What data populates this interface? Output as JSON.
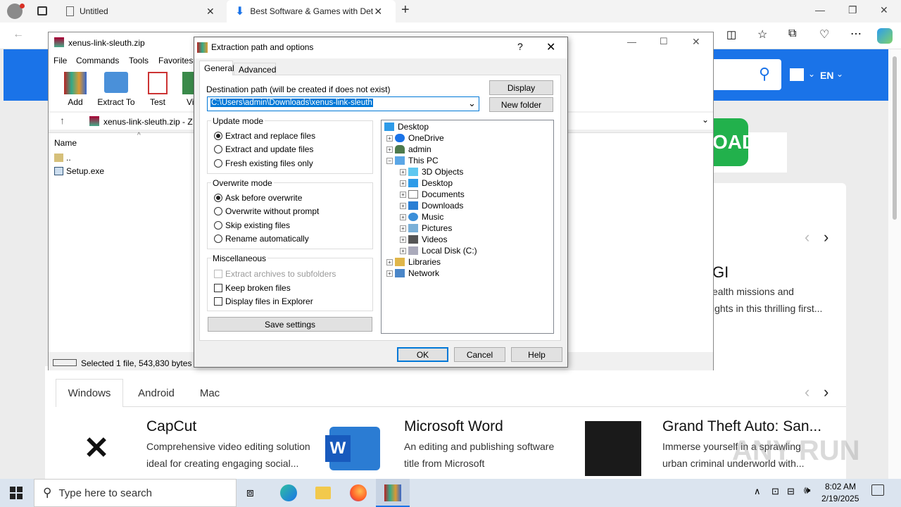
{
  "browser": {
    "tabs": [
      {
        "label": "Untitled"
      },
      {
        "label": "Best Software & Games with Det"
      }
    ],
    "new_tab": "+"
  },
  "webpage": {
    "lang": "EN",
    "download_fragment": "OAD",
    "featured_title_fragment": "GI",
    "featured_desc1": "ealth missions and",
    "featured_desc2": "ights in this thrilling first...",
    "platform_tabs": [
      "Windows",
      "Android",
      "Mac"
    ],
    "products": [
      {
        "title": "CapCut",
        "desc": "Comprehensive video editing solution ideal for creating engaging social..."
      },
      {
        "title": "Microsoft Word",
        "desc": "An editing and publishing software title from Microsoft"
      },
      {
        "title": "Grand Theft Auto: San...",
        "desc": "Immerse yourself in a sprawling urban criminal underworld with..."
      }
    ],
    "watermark": "ANY RUN"
  },
  "winrar": {
    "title": "xenus-link-sleuth.zip",
    "menu": [
      "File",
      "Commands",
      "Tools",
      "Favorites"
    ],
    "toolbar": [
      "Add",
      "Extract To",
      "Test",
      "Vi"
    ],
    "address": "xenus-link-sleuth.zip - Z",
    "column_name": "Name",
    "files": [
      "..",
      "Setup.exe"
    ],
    "status": "Selected 1 file, 543,830 bytes"
  },
  "dialog": {
    "title": "Extraction path and options",
    "help_glyph": "?",
    "tabs": [
      "General",
      "Advanced"
    ],
    "dest_label": "Destination path (will be created if does not exist)",
    "dest_value": "C:\\Users\\admin\\Downloads\\xenus-link-sleuth",
    "display_btn": "Display",
    "newfolder_btn": "New folder",
    "update_mode": {
      "label": "Update mode",
      "options": [
        "Extract and replace files",
        "Extract and update files",
        "Fresh existing files only"
      ],
      "selected": 0
    },
    "overwrite_mode": {
      "label": "Overwrite mode",
      "options": [
        "Ask before overwrite",
        "Overwrite without prompt",
        "Skip existing files",
        "Rename automatically"
      ],
      "selected": 0
    },
    "misc": {
      "label": "Miscellaneous",
      "options": [
        "Extract archives to subfolders",
        "Keep broken files",
        "Display files in Explorer"
      ]
    },
    "save_btn": "Save settings",
    "tree": [
      "Desktop",
      "OneDrive",
      "admin",
      "This PC",
      "3D Objects",
      "Desktop",
      "Documents",
      "Downloads",
      "Music",
      "Pictures",
      "Videos",
      "Local Disk (C:)",
      "Libraries",
      "Network"
    ],
    "ok": "OK",
    "cancel": "Cancel",
    "help": "Help"
  },
  "taskbar": {
    "search_placeholder": "Type here to search",
    "time": "8:02 AM",
    "date": "2/19/2025"
  }
}
